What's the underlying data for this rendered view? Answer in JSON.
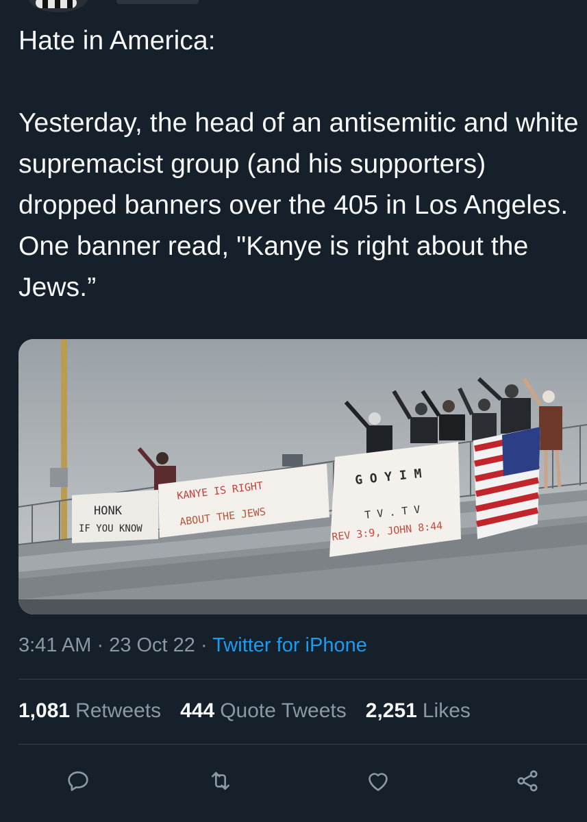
{
  "tweet": {
    "text": "Hate in America:\n\nYesterday, the head of an antisemitic and white supremacist group (and his supporters) dropped banners over the 405 in Los Angeles. One banner read, \"Kanye is right about the Jews.”",
    "time": "3:41 AM",
    "sep1": " · ",
    "date": "23 Oct 22",
    "sep2": " · ",
    "source": "Twitter for iPhone"
  },
  "media": {
    "banners": {
      "honk_line1": "HONK",
      "honk_line2": "IF YOU KNOW",
      "kanye_line1": "KANYE  IS  RIGHT",
      "kanye_line2": "ABOUT  THE  JEWS",
      "goyim_line1": "G O Y I M",
      "goyim_line2": "T V . T V",
      "goyim_line3": "REV 3:9, JOHN 8:44"
    }
  },
  "stats": {
    "retweets_count": "1,081",
    "retweets_label": "Retweets",
    "quotes_count": "444",
    "quotes_label": "Quote Tweets",
    "likes_count": "2,251",
    "likes_label": "Likes"
  },
  "actions": {
    "reply": "reply-icon",
    "retweet": "retweet-icon",
    "like": "heart-icon",
    "share": "share-icon"
  },
  "colors": {
    "background": "#15202b",
    "text": "#f7f9f9",
    "secondary": "#8b98a5",
    "accent": "#1d9bf0",
    "divider": "#38444d"
  }
}
